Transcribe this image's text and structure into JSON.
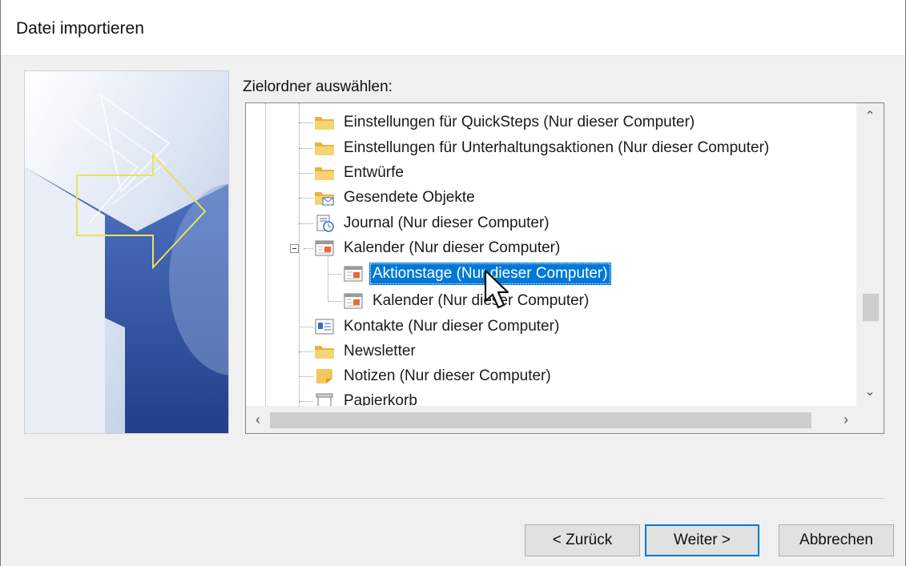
{
  "window": {
    "title": "Datei importieren"
  },
  "prompt": "Zielordner auswählen:",
  "tree": {
    "items": [
      {
        "label": "Einstellungen für QuickSteps (Nur dieser Computer)",
        "icon": "folder-icon",
        "level": 1
      },
      {
        "label": "Einstellungen für Unterhaltungsaktionen (Nur dieser Computer)",
        "icon": "folder-icon",
        "level": 1
      },
      {
        "label": "Entwürfe",
        "icon": "folder-icon",
        "level": 1
      },
      {
        "label": "Gesendete Objekte",
        "icon": "sent-items-icon",
        "level": 1
      },
      {
        "label": "Journal (Nur dieser Computer)",
        "icon": "journal-icon",
        "level": 1
      },
      {
        "label": "Kalender (Nur dieser Computer)",
        "icon": "calendar-icon",
        "level": 1,
        "expanded": true
      },
      {
        "label": "Aktionstage (Nur dieser Computer)",
        "icon": "calendar-icon",
        "level": 2,
        "selected": true
      },
      {
        "label": "Kalender (Nur dieser Computer)",
        "icon": "calendar-icon",
        "level": 2
      },
      {
        "label": "Kontakte (Nur dieser Computer)",
        "icon": "contacts-icon",
        "level": 1
      },
      {
        "label": "Newsletter",
        "icon": "folder-icon",
        "level": 1
      },
      {
        "label": "Notizen (Nur dieser Computer)",
        "icon": "notes-icon",
        "level": 1
      },
      {
        "label": "Papierkorb",
        "icon": "trash-icon",
        "level": 1
      }
    ]
  },
  "buttons": {
    "back": "< Zurück",
    "next": "Weiter >",
    "cancel": "Abbrechen"
  },
  "colors": {
    "selection": "#0078d7",
    "folder": "#f5c542",
    "accent": "#0078d7"
  }
}
